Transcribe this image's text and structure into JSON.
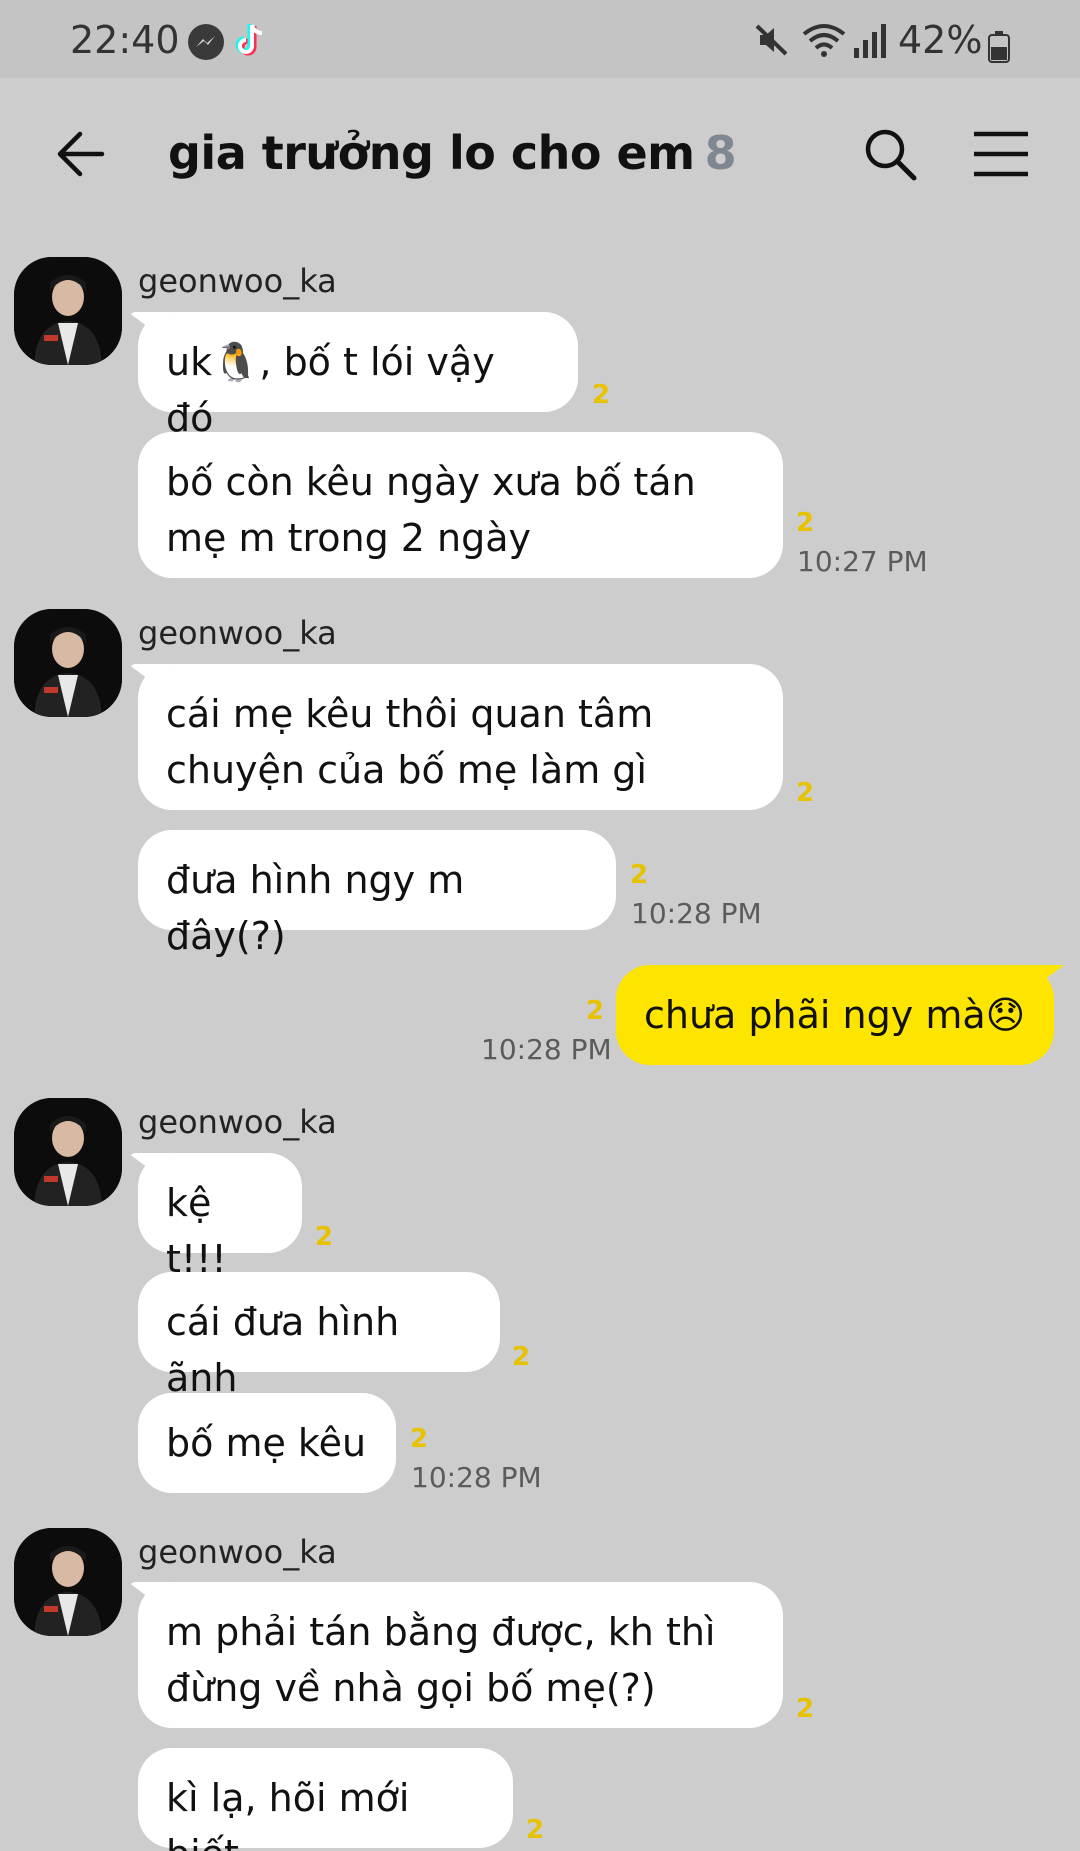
{
  "status_bar": {
    "time": "22:40",
    "battery": "42%",
    "icons": [
      "messenger-icon",
      "tiktok-icon",
      "mute-icon",
      "wifi-icon",
      "signal-icon",
      "battery-icon"
    ]
  },
  "header": {
    "title": "gia trưởng lo cho em",
    "member_count": "8",
    "icons": [
      "back-arrow-icon",
      "search-icon",
      "menu-icon"
    ]
  },
  "colors": {
    "background": "#cdcdcd",
    "incoming_bubble": "#ffffff",
    "outgoing_bubble": "#fee500",
    "read_count": "#e6c200"
  },
  "messages": [
    {
      "sender": "geonwoo_ka"
    },
    {
      "text": "uk🐧, bố t lói vậy đó",
      "read": "2"
    },
    {
      "text": "bố còn kêu ngày xưa bố tán",
      "text2": "mẹ m trong 2 ngày",
      "read": "2",
      "time": "10:27 PM"
    },
    {
      "sender": "geonwoo_ka"
    },
    {
      "text": "cái mẹ kêu thôi quan tâm",
      "text2": "chuyện của bố mẹ làm gì",
      "read": "2"
    },
    {
      "text": "đưa hình ngy m đây(?)",
      "read": "2",
      "time": "10:28 PM"
    },
    {
      "text": "chưa phãi ngy mà😞",
      "read": "2",
      "time": "10:28 PM"
    },
    {
      "sender": "geonwoo_ka"
    },
    {
      "text": "kệ t!!!",
      "read": "2"
    },
    {
      "text": "cái đưa hình ãnh",
      "read": "2"
    },
    {
      "text": "bố mẹ kêu",
      "read": "2",
      "time": "10:28 PM"
    },
    {
      "sender": "geonwoo_ka"
    },
    {
      "text": "m phải tán bằng được, kh thì",
      "text2": "đừng về nhà gọi bố mẹ(?)",
      "read": "2"
    },
    {
      "text": "kì lạ, hõi mới biết",
      "read": "2"
    }
  ]
}
